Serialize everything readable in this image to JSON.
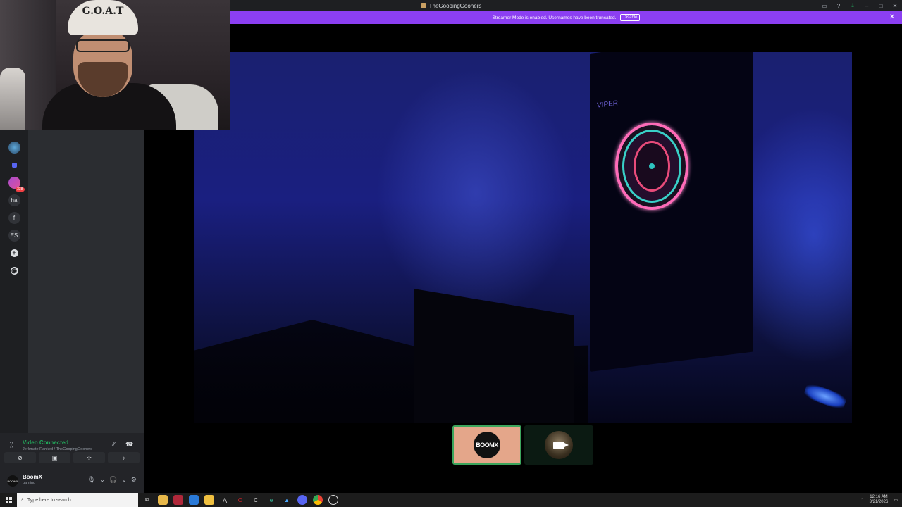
{
  "window": {
    "title": "TheGoopingGooners",
    "controls": [
      "inbox-icon",
      "help-icon",
      "download-icon",
      "minimize-icon",
      "maximize-icon",
      "close-icon"
    ]
  },
  "streamer_banner": {
    "message": "Streamer Mode is enabled. Usernames have been truncated.",
    "button": "Disable",
    "bg_color": "#8c3ff2"
  },
  "webcam": {
    "cap_text": "G.O.A.T"
  },
  "video": {
    "board_brand": "VIPER"
  },
  "guilds": [
    {
      "type": "server",
      "label": "",
      "icon": "server-avatar"
    },
    {
      "type": "folder",
      "label": "",
      "icon": "folder-icon"
    },
    {
      "type": "server",
      "label": "",
      "icon": "server-avatar",
      "badge": "338"
    },
    {
      "type": "text",
      "label": "ha"
    },
    {
      "type": "text",
      "label": "f"
    },
    {
      "type": "text",
      "label": "ES"
    },
    {
      "type": "action",
      "label": "+",
      "icon": "add-server-icon"
    },
    {
      "type": "action",
      "label": "◉",
      "icon": "discover-icon"
    }
  ],
  "voice": {
    "status": "Video Connected",
    "channel": "Jerkmate Ranked / TheGoopingGooners",
    "buttons": [
      "camera-off-icon",
      "screen-share-icon",
      "activities-icon",
      "soundboard-icon"
    ]
  },
  "user": {
    "name": "BoomX",
    "avatar_text": "BOOMX",
    "status": "gaming"
  },
  "tiles": [
    {
      "label": "BOOMX",
      "accent": "#e4a68a",
      "speaking": true
    },
    {
      "label": "",
      "accent": "#0b1a12",
      "speaking": false,
      "icon": "video-camera-icon"
    }
  ],
  "taskbar": {
    "search_placeholder": "Type here to search",
    "time": "12:16 AM",
    "date": "3/21/2026"
  }
}
